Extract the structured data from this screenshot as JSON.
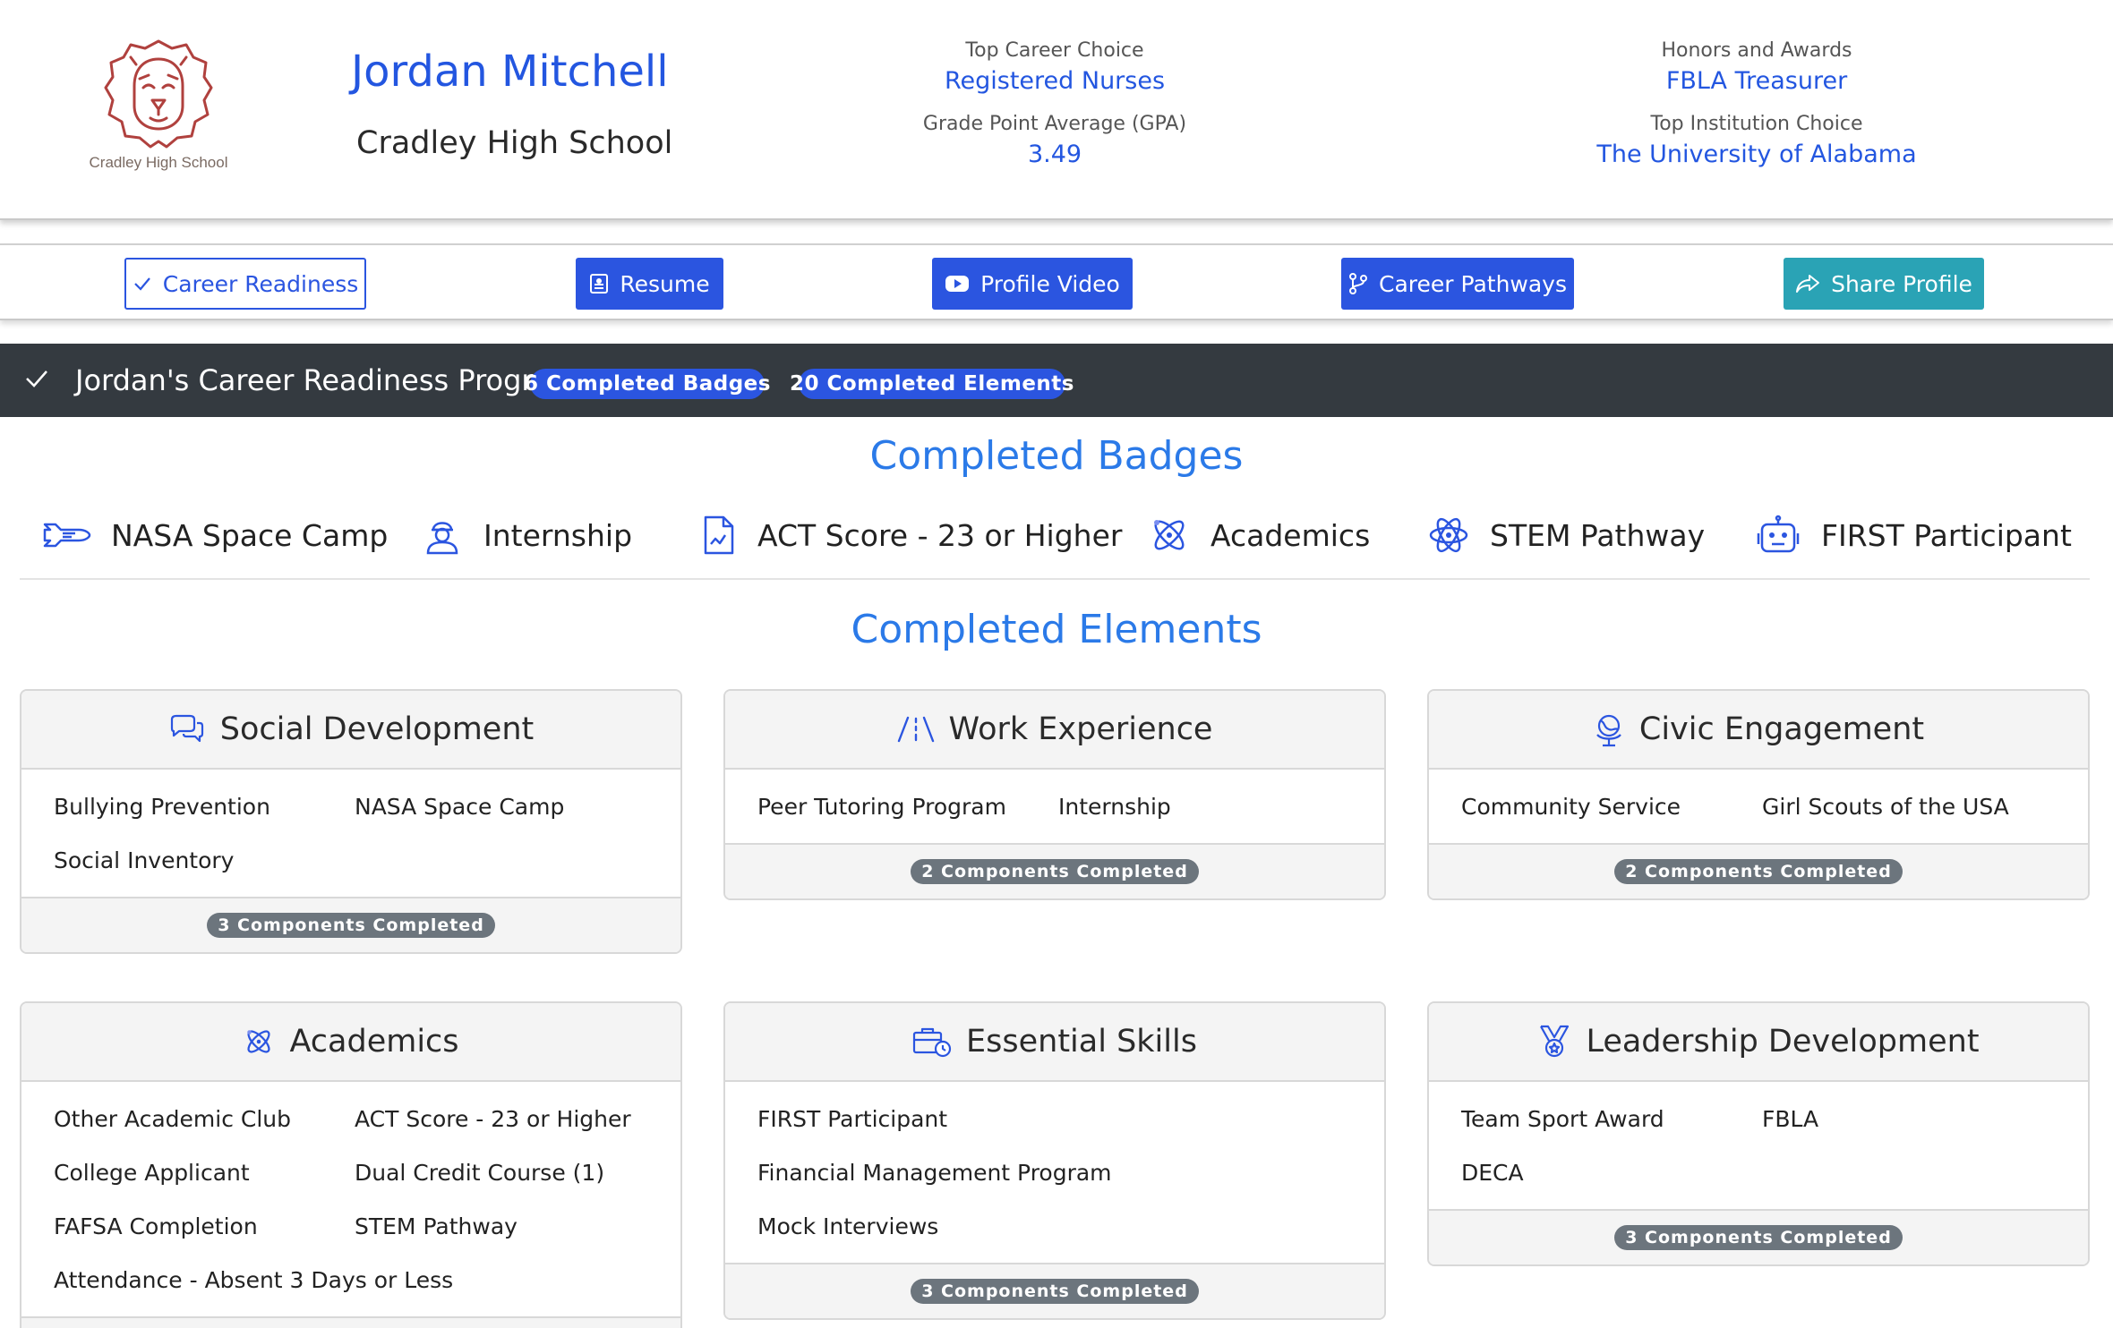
{
  "header": {
    "logo_text": "Cradley High School",
    "student_name": "Jordan Mitchell",
    "school_name": "Cradley High School",
    "stats": {
      "career_label": "Top Career Choice",
      "career_value": "Registered Nurses",
      "gpa_label": "Grade Point Average (GPA)",
      "gpa_value": "3.49",
      "honors_label": "Honors and Awards",
      "honors_value": "FBLA Treasurer",
      "institution_label": "Top Institution Choice",
      "institution_value": "The University of Alabama"
    }
  },
  "actions": {
    "career_readiness": "Career Readiness",
    "resume": "Resume",
    "profile_video": "Profile Video",
    "career_pathways": "Career Pathways",
    "share_profile": "Share Profile"
  },
  "progress": {
    "title": "Jordan's Career Readiness Progress",
    "badges_pill": "6 Completed Badges",
    "elements_pill": "20 Completed Elements"
  },
  "badges_section": {
    "title": "Completed Badges",
    "items": [
      {
        "label": "NASA Space Camp",
        "icon": "space-shuttle-icon"
      },
      {
        "label": "Internship",
        "icon": "worker-icon"
      },
      {
        "label": "ACT Score - 23 or Higher",
        "icon": "document-chart-icon"
      },
      {
        "label": "Academics",
        "icon": "atom-icon"
      },
      {
        "label": "STEM Pathway",
        "icon": "atom-icon"
      },
      {
        "label": "FIRST Participant",
        "icon": "robot-icon"
      }
    ]
  },
  "elements_section": {
    "title": "Completed Elements",
    "cards": [
      {
        "title": "Social Development",
        "icon": "chat-bubbles-icon",
        "items": [
          "Bullying Prevention",
          "NASA Space Camp",
          "Social Inventory"
        ],
        "footer": "3 Components Completed"
      },
      {
        "title": "Work Experience",
        "icon": "road-icon",
        "items": [
          "Peer Tutoring Program",
          "Internship"
        ],
        "footer": "2 Components Completed"
      },
      {
        "title": "Civic Engagement",
        "icon": "globe-icon",
        "items": [
          "Community Service",
          "Girl Scouts of the USA"
        ],
        "footer": "2 Components Completed"
      },
      {
        "title": "Academics",
        "icon": "atom-icon",
        "items": [
          "Other Academic Club",
          "ACT Score - 23 or Higher",
          "College Applicant",
          "Dual Credit Course (1)",
          "FAFSA Completion",
          "STEM Pathway",
          "Attendance - Absent 3 Days or Less"
        ]
      },
      {
        "title": "Essential Skills",
        "icon": "briefcase-clock-icon",
        "items": [
          "FIRST Participant",
          "Financial Management Program",
          "Mock Interviews"
        ],
        "footer": "3 Components Completed"
      },
      {
        "title": "Leadership Development",
        "icon": "medal-icon",
        "items": [
          "Team Sport Award",
          "FBLA",
          "DECA"
        ],
        "footer": "3 Components Completed"
      }
    ]
  },
  "colors": {
    "brand_blue": "#2b55e0",
    "link_blue": "#2356e0",
    "title_blue": "#2b7ae8",
    "teal": "#2aa3b5",
    "dark_bar": "#343a40",
    "footer_pill": "#6c757d",
    "logo_red": "#b0413e"
  }
}
